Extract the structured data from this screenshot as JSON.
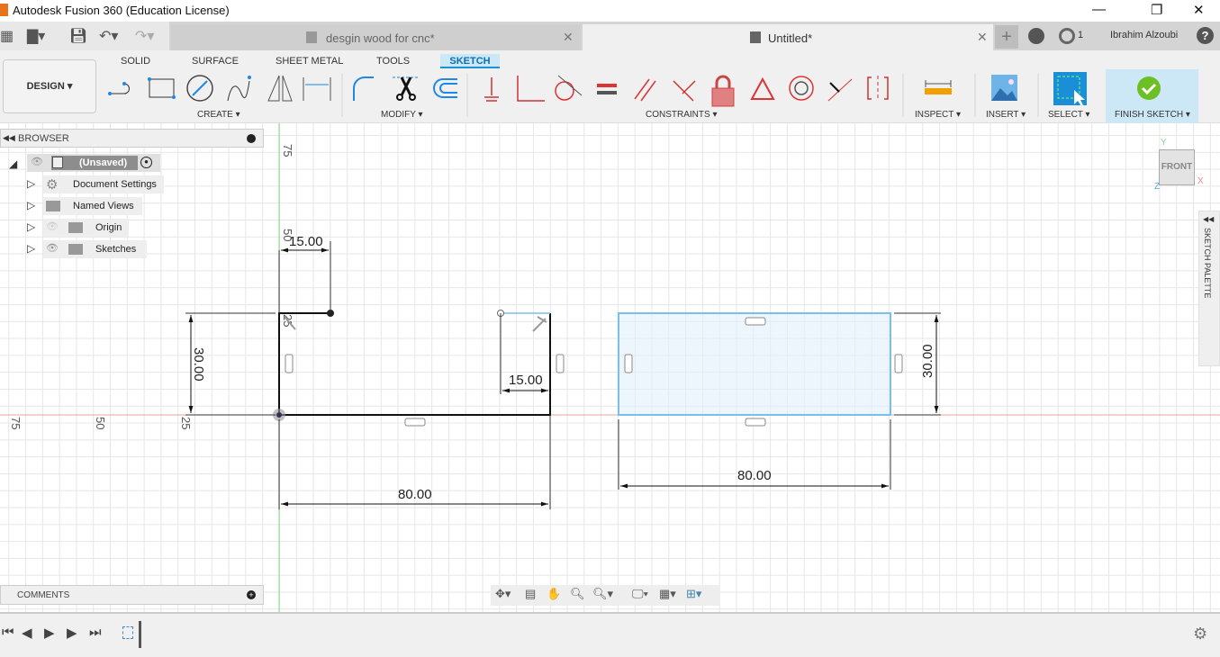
{
  "window": {
    "title": "Autodesk Fusion 360 (Education License)",
    "minimize": "—",
    "maximize": "❐",
    "close": "✕"
  },
  "tabs": [
    {
      "label": "desgin wood for cnc*",
      "active": false
    },
    {
      "label": "Untitled*",
      "active": true
    }
  ],
  "tabbar": {
    "new_tab": "+",
    "jobs_count": "1",
    "user": "Ibrahim Alzoubi",
    "help": "?"
  },
  "ribbon": {
    "workspace": "DESIGN ▾",
    "tabs": [
      "SOLID",
      "SURFACE",
      "SHEET METAL",
      "TOOLS",
      "SKETCH"
    ],
    "active_tab": "SKETCH",
    "groups": {
      "create": "CREATE ▾",
      "modify": "MODIFY ▾",
      "constraints": "CONSTRAINTS ▾",
      "inspect": "INSPECT ▾",
      "insert": "INSERT ▾",
      "select": "SELECT ▾",
      "finish": "FINISH SKETCH ▾"
    },
    "accent": "#0696d7",
    "finish_color": "#6cc024"
  },
  "browser": {
    "title": "BROWSER",
    "root": "(Unsaved)",
    "items": [
      "Document Settings",
      "Named Views",
      "Origin",
      "Sketches"
    ]
  },
  "comments": {
    "title": "COMMENTS"
  },
  "viewcube": {
    "face": "FRONT",
    "x": "X",
    "y": "Y",
    "z": "Z"
  },
  "sketch_palette": {
    "label": "SKETCH PALETTE"
  },
  "canvas": {
    "axis_labels_x": [
      "75",
      "50",
      "25"
    ],
    "axis_labels_y": [
      "75",
      "50",
      "25"
    ],
    "dimensions": {
      "left_top_width": "15.00",
      "left_height": "30.00",
      "right_notch": "15.00",
      "bottom_width": "80.00",
      "rect_height": "30.00",
      "rect_width": "80.00"
    },
    "colors": {
      "x_axis": "#e88080",
      "y_axis": "#80e080",
      "selection": "#7bbfe8"
    }
  }
}
